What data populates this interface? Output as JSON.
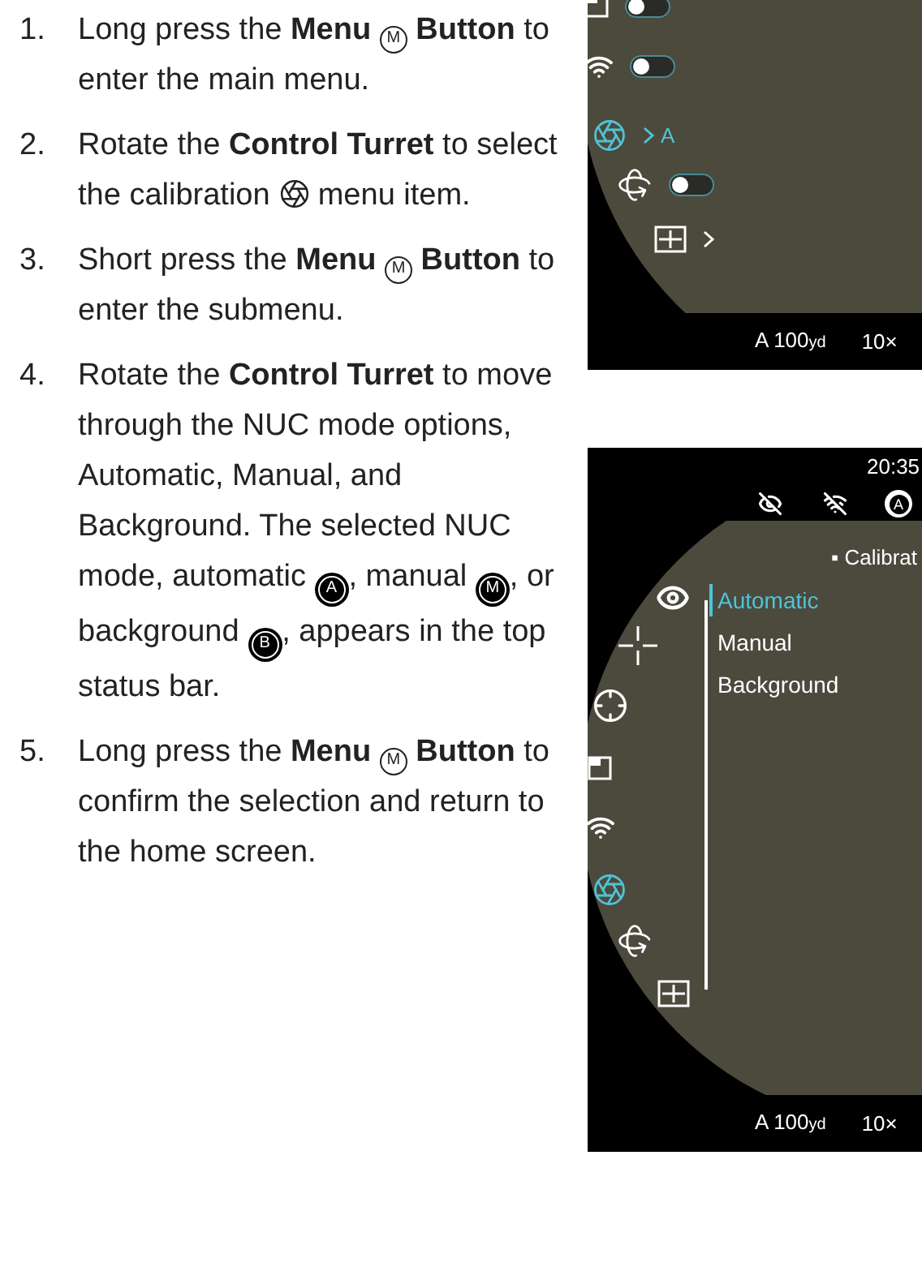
{
  "steps": [
    {
      "number": "1.",
      "parts": [
        {
          "kind": "text",
          "text": "Long press the **Menu**"
        },
        {
          "kind": "key",
          "letter": "M"
        },
        {
          "kind": "text",
          "text": "**Button** to enter the main menu."
        }
      ]
    },
    {
      "number": "2.",
      "parts": [
        {
          "kind": "text",
          "text": "Rotate the **Control Turret** to select the calibration"
        },
        {
          "kind": "calibration"
        },
        {
          "kind": "text",
          "text": "menu item."
        }
      ]
    },
    {
      "number": "3.",
      "parts": [
        {
          "kind": "text",
          "text": "Short press the **Menu**"
        },
        {
          "kind": "key",
          "letter": "M"
        },
        {
          "kind": "text",
          "text": "**Button** to enter the submenu."
        }
      ]
    },
    {
      "number": "4.",
      "parts": [
        {
          "kind": "text",
          "text": "Rotate the **Control Turret** to move through the NUC mode options, Automatic, Manual, and Background. The selected NUC mode, automatic"
        },
        {
          "kind": "nuc",
          "letter": "A"
        },
        {
          "kind": "text",
          "text": ", manual"
        },
        {
          "kind": "nuc",
          "letter": "M"
        },
        {
          "kind": "text",
          "text": ", or background"
        },
        {
          "kind": "nuc",
          "letter": "B"
        },
        {
          "kind": "text",
          "text": ", appears in the top status bar."
        }
      ]
    },
    {
      "number": "5.",
      "parts": [
        {
          "kind": "text",
          "text": "Long press the **Menu**"
        },
        {
          "kind": "key",
          "letter": "M"
        },
        {
          "kind": "text",
          "text": "**Button** to confirm the selection and return to the home screen."
        }
      ]
    }
  ],
  "main_menu_screen": {
    "items": [
      {
        "kind": "display",
        "selected": false,
        "on": false
      },
      {
        "kind": "wifi",
        "selected": false,
        "on": false
      },
      {
        "kind": "calibration",
        "selected": true,
        "submenu": true,
        "value": "A"
      },
      {
        "kind": "rotation",
        "selected": false,
        "on": false
      },
      {
        "kind": "layout",
        "selected": false,
        "submenu": true
      }
    ],
    "range": "A 100",
    "unit": "yd",
    "zoom": "10×"
  },
  "calibration_screen": {
    "time": "20:35",
    "nuc_letter": "A",
    "title": "▪ Calibrat",
    "items": [
      {
        "kind": "eye",
        "selected": false
      },
      {
        "kind": "crosshair",
        "selected": false
      },
      {
        "kind": "target",
        "selected": false
      },
      {
        "kind": "display",
        "selected": false
      },
      {
        "kind": "wifi",
        "selected": false
      },
      {
        "kind": "calibration",
        "selected": true
      },
      {
        "kind": "rotation",
        "selected": false
      },
      {
        "kind": "layout",
        "selected": false
      }
    ],
    "options": [
      {
        "label": "Automatic",
        "selected": true
      },
      {
        "label": "Manual",
        "selected": false
      },
      {
        "label": "Background",
        "selected": false
      }
    ],
    "range": "A 100",
    "unit": "yd",
    "zoom": "10×"
  }
}
